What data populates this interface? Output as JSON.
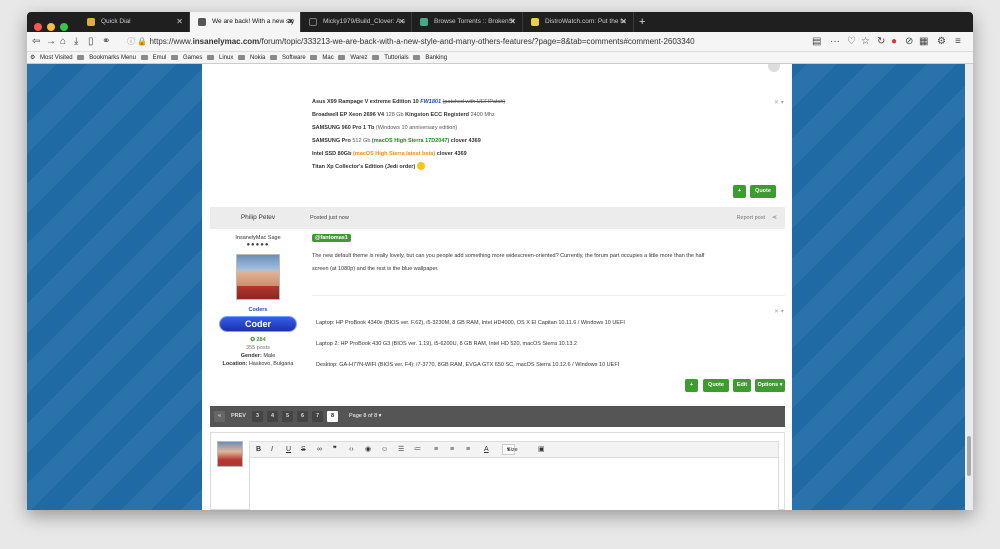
{
  "tabs": [
    {
      "label": "Quick Dial",
      "active": false
    },
    {
      "label": "We are back! With a new sty",
      "active": true
    },
    {
      "label": "Micky1979/Build_Clover: A s",
      "active": false
    },
    {
      "label": "Browse Torrents :: BrokenSt",
      "active": false
    },
    {
      "label": "DistroWatch.com: Put the fu",
      "active": false
    }
  ],
  "url": {
    "prefix": "https://www.",
    "domain": "insanelymac.com",
    "path": "/forum/topic/333213-we-are-back-with-a-new-style-and-many-others-features/?page=8&tab=comments#comment-2603340"
  },
  "bookmarks": [
    "Most Visited",
    "Bookmarks Menu",
    "Emul",
    "Games",
    "Linux",
    "Nokia",
    "Software",
    "Mac",
    "Warez",
    "Tuttorials",
    "Banking"
  ],
  "signature1": {
    "line1_bold": "Asus X99 Rampage V extreme Edition 10",
    "line1_fw": "FW1801",
    "line1_strike": "(patched with UEFIPatch)",
    "line2_bold": "Broadwell EP Xeon 2696 V4",
    "line2_mid": "128 Gb",
    "line2_bold2": "Kingston ECC Registerd",
    "line2_end": "2400 Mhz",
    "line3_bold": "SAMSUNG 960 Pro 1 Tb",
    "line3_end": "(Windows 10 anniversary edition)",
    "line4_bold": "SAMSUNG Pro",
    "line4_mid": "512 Gb",
    "line4_green": "(macOS High Sierra 17D2047)",
    "line4_end": "clover 4369",
    "line5_bold": "Intel SSD 80Gb",
    "line5_orange": "(macOS High Sierra latest beta)",
    "line5_end": "clover 4369",
    "line6_bold": "Titan Xp Collector's Edition (Jedi order)",
    "plus": "+",
    "quote": "Quote"
  },
  "post": {
    "author": "Philip Petev",
    "posted": "Posted just now",
    "report": "Report post",
    "rank": "InsanelyMac Sage",
    "group": "Coders",
    "badge": "Coder",
    "rep": "284",
    "posts": "355 posts",
    "gender_label": "Gender:",
    "gender": "Male",
    "location_label": "Location:",
    "location": "Haskovo, Bulgaria",
    "mention": "@fantomas1",
    "body1": "The new default theme is really lovely, but can you people add something more widescreen-oriented? Currently, the forum part occupies a little more than the half",
    "body2": "screen (at 1080p) and the rest is the blue wallpaper.",
    "sig1": "Laptop: HP ProBook 4340s (BIOS ver. F.62), i5-3230M, 8 GB RAM, Intel HD4000, OS X El Capitan 10.11.6 / Windows 10 UEFI",
    "sig2": "Laptop 2: HP ProBook 430 G3 (BIOS ver. 1.19), i5-6200U, 8 GB RAM, Intel HD 520, macOS Sierra 10.13.2",
    "sig3": "Desktop: GA-H77N-WIFI (BIOS ver. F4): i7-3770, 8GB RAM, EVGA GTX 650 SC, macOS Sierra 10.12.6 / Windows 10 UEFI",
    "plus": "+",
    "quote": "Quote",
    "edit": "Edit",
    "options": "Options"
  },
  "pager": {
    "prev": "PREV",
    "pages": [
      "3",
      "4",
      "5",
      "6",
      "7",
      "8"
    ],
    "current": "8",
    "label": "Page 8 of 8"
  },
  "editor": {
    "size": "Size"
  },
  "colors": {
    "accent_green": "#3c9d2e",
    "background_blue": "#1f6aa5",
    "coder_badge": "#2a45d0"
  }
}
